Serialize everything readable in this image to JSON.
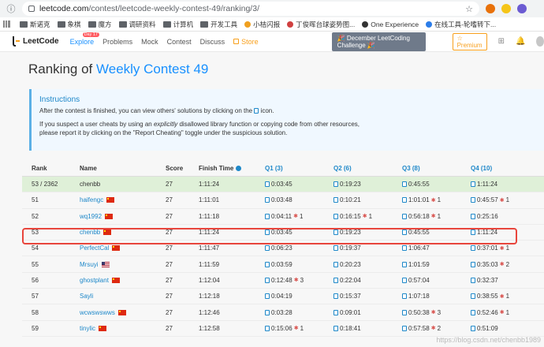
{
  "browser": {
    "url_host": "leetcode.com",
    "url_path": "/contest/leetcode-weekly-contest-49/ranking/3/"
  },
  "bookmarks": [
    {
      "label": "斯诺克",
      "icon": "folder"
    },
    {
      "label": "象棋",
      "icon": "folder"
    },
    {
      "label": "魔方",
      "icon": "folder"
    },
    {
      "label": "调研资料",
      "icon": "folder"
    },
    {
      "label": "计算机",
      "icon": "folder"
    },
    {
      "label": "开发工具",
      "icon": "folder"
    },
    {
      "label": "小桔闪报",
      "icon": "dot",
      "color": "#f0a020"
    },
    {
      "label": "丁俊晖台球姿势图...",
      "icon": "dot",
      "color": "#d04040"
    },
    {
      "label": "One Experience",
      "icon": "dot",
      "color": "#333333"
    },
    {
      "label": "在线工具-轮嗜转下...",
      "icon": "dot",
      "color": "#2b7de9"
    }
  ],
  "nav": {
    "logo": "LeetCode",
    "links": [
      "Explore",
      "Problems",
      "Mock",
      "Contest",
      "Discuss"
    ],
    "explore_badge": "Day 17",
    "store": "Store",
    "promo": "🎉 December LeetCoding Challenge 🎉",
    "premium": "☆ Premium"
  },
  "page": {
    "title_prefix": "Ranking of ",
    "title_contest": "Weekly Contest 49"
  },
  "instructions": {
    "heading": "Instructions",
    "p1_before": "After the contest is finished, you can view others' solutions by clicking on the ",
    "p1_after": " icon.",
    "p2_a": "If you suspect a user cheats by using an ",
    "p2_em": "explicitly",
    "p2_b": " disallowed library function or copying code from other resources,",
    "p2_c": "please report it by clicking on the \"Report Cheating\" toggle under the suspicious solution."
  },
  "table": {
    "headers": {
      "rank": "Rank",
      "name": "Name",
      "score": "Score",
      "finish": "Finish Time",
      "q1": "Q1 (3)",
      "q2": "Q2 (6)",
      "q3": "Q3 (8)",
      "q4": "Q4 (10)"
    },
    "rows": [
      {
        "rank": "53 / 2362",
        "name": "chenbb",
        "flag": "",
        "score": "27",
        "finish": "1:11:24",
        "q": [
          {
            "t": "0:03:45",
            "p": ""
          },
          {
            "t": "0:19:23",
            "p": ""
          },
          {
            "t": "0:45:55",
            "p": ""
          },
          {
            "t": "1:11:24",
            "p": ""
          }
        ],
        "self": true
      },
      {
        "rank": "51",
        "name": "haifengc",
        "flag": "cn",
        "score": "27",
        "finish": "1:11:01",
        "q": [
          {
            "t": "0:03:48",
            "p": ""
          },
          {
            "t": "0:10:21",
            "p": ""
          },
          {
            "t": "1:01:01",
            "p": "1"
          },
          {
            "t": "0:45:57",
            "p": "1"
          }
        ]
      },
      {
        "rank": "52",
        "name": "wq1992",
        "flag": "cn",
        "score": "27",
        "finish": "1:11:18",
        "q": [
          {
            "t": "0:04:11",
            "p": "1"
          },
          {
            "t": "0:16:15",
            "p": "1"
          },
          {
            "t": "0:56:18",
            "p": "1"
          },
          {
            "t": "0:25:16",
            "p": ""
          }
        ]
      },
      {
        "rank": "53",
        "name": "chenbb",
        "flag": "cn",
        "score": "27",
        "finish": "1:11:24",
        "q": [
          {
            "t": "0:03:45",
            "p": ""
          },
          {
            "t": "0:19:23",
            "p": ""
          },
          {
            "t": "0:45:55",
            "p": ""
          },
          {
            "t": "1:11:24",
            "p": ""
          }
        ]
      },
      {
        "rank": "54",
        "name": "PerfectCal",
        "flag": "cn",
        "score": "27",
        "finish": "1:11:47",
        "q": [
          {
            "t": "0:06:23",
            "p": ""
          },
          {
            "t": "0:19:37",
            "p": ""
          },
          {
            "t": "1:06:47",
            "p": ""
          },
          {
            "t": "0:37:01",
            "p": "1"
          }
        ]
      },
      {
        "rank": "55",
        "name": "Mrsuyi",
        "flag": "us",
        "score": "27",
        "finish": "1:11:59",
        "q": [
          {
            "t": "0:03:59",
            "p": ""
          },
          {
            "t": "0:20:23",
            "p": ""
          },
          {
            "t": "1:01:59",
            "p": ""
          },
          {
            "t": "0:35:03",
            "p": "2"
          }
        ]
      },
      {
        "rank": "56",
        "name": "ghostplant",
        "flag": "cn",
        "score": "27",
        "finish": "1:12:04",
        "q": [
          {
            "t": "0:12:48",
            "p": "3"
          },
          {
            "t": "0:22:04",
            "p": ""
          },
          {
            "t": "0:57:04",
            "p": ""
          },
          {
            "t": "0:32:37",
            "p": ""
          }
        ]
      },
      {
        "rank": "57",
        "name": "Sayli",
        "flag": "",
        "score": "27",
        "finish": "1:12:18",
        "q": [
          {
            "t": "0:04:19",
            "p": ""
          },
          {
            "t": "0:15:37",
            "p": ""
          },
          {
            "t": "1:07:18",
            "p": ""
          },
          {
            "t": "0:38:55",
            "p": "1"
          }
        ]
      },
      {
        "rank": "58",
        "name": "wcwswswws",
        "flag": "cn",
        "score": "27",
        "finish": "1:12:46",
        "q": [
          {
            "t": "0:03:28",
            "p": ""
          },
          {
            "t": "0:09:01",
            "p": ""
          },
          {
            "t": "0:50:38",
            "p": "3"
          },
          {
            "t": "0:52:46",
            "p": "1"
          }
        ]
      },
      {
        "rank": "59",
        "name": "tinylic",
        "flag": "cn",
        "score": "27",
        "finish": "1:12:58",
        "q": [
          {
            "t": "0:15:06",
            "p": "1"
          },
          {
            "t": "0:18:41",
            "p": ""
          },
          {
            "t": "0:57:58",
            "p": "2"
          },
          {
            "t": "0:51:09",
            "p": ""
          }
        ]
      }
    ]
  },
  "watermark": "https://blog.csdn.net/chenbb1989"
}
